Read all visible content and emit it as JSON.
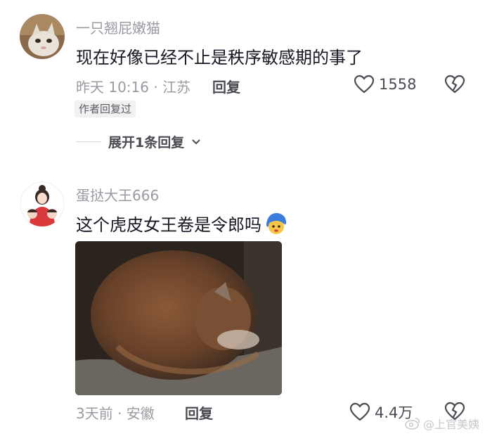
{
  "comments": [
    {
      "username": "一只翘屁嫩猫",
      "text": "现在好像已经不止是秩序敏感期的事了",
      "meta": "昨天 10:16 · 江苏",
      "reply_label": "回复",
      "like_count": "1558",
      "author_badge": "作者回复过",
      "expand_label": "展开1条回复"
    },
    {
      "username": "蛋挞大王666",
      "text": "这个虎皮女王卷是令郎吗",
      "meta": "3天前 · 安徽",
      "reply_label": "回复",
      "like_count": "4.4万"
    }
  ],
  "watermark": "@上官美姨",
  "colors": {
    "username": "#9a9ba2",
    "text": "#161823",
    "badge_bg": "#f1f1f2"
  }
}
